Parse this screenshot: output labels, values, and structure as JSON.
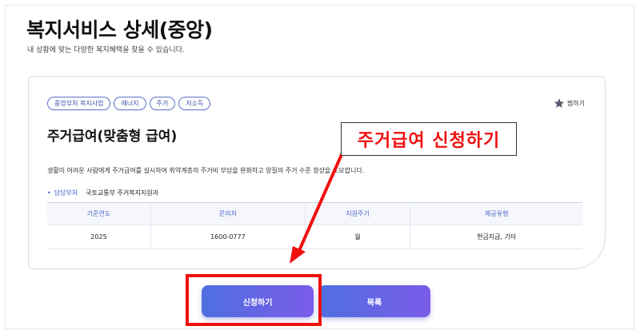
{
  "page": {
    "title": "복지서비스 상세(중앙)",
    "subtitle": "내 상황에 맞는 다양한 복지혜택을 찾을 수 있습니다."
  },
  "service": {
    "tags": [
      "중앙부처 복지사업",
      "에너지",
      "주거",
      "저소득"
    ],
    "bookmark_label": "찜하기",
    "title": "주거급여(맞춤형 급여)",
    "description": "생활이 어려운 사람에게 주거급여를 실시하여 취약계층의 주거비 부담을 완화하고 양질의 주거 수준 향상을 도모합니다.",
    "department_label": "담당부처",
    "department_value": "국토교통부 주거복지지원과"
  },
  "table": {
    "headers": [
      "기준연도",
      "문의처",
      "지원주기",
      "제공유형"
    ],
    "row": [
      "2025",
      "1600-0777",
      "월",
      "현금지급, 기타"
    ]
  },
  "buttons": {
    "apply_label": "신청하기",
    "list_label": "목록"
  },
  "annotation": {
    "callout_text": "주거급여 신청하기",
    "color": "#f01010"
  },
  "colors": {
    "accent": "#4f6fe0",
    "accent_end": "#7a5ce8",
    "tag_border": "#5a6ec8"
  }
}
